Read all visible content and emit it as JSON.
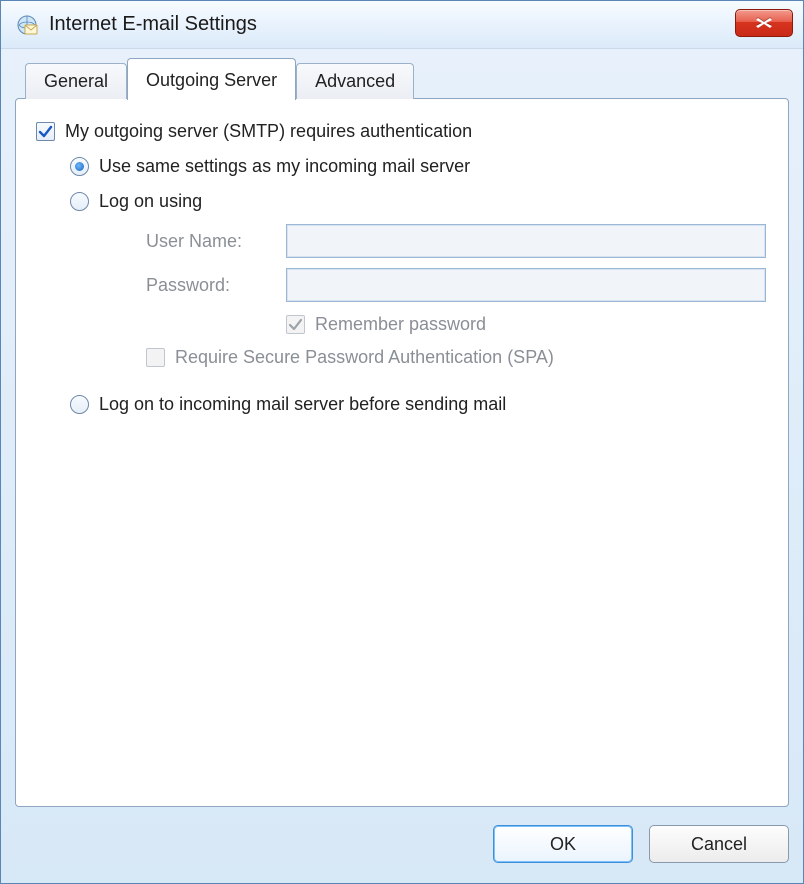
{
  "window": {
    "title": "Internet E-mail Settings"
  },
  "tabs": {
    "general": "General",
    "outgoing": "Outgoing Server",
    "advanced": "Advanced"
  },
  "form": {
    "requiresAuth": "My outgoing server (SMTP) requires authentication",
    "useSame": "Use same settings as my incoming mail server",
    "logOnUsing": "Log on using",
    "userNameLabel": "User Name:",
    "userNameValue": "",
    "passwordLabel": "Password:",
    "passwordValue": "",
    "rememberPassword": "Remember password",
    "requireSPA": "Require Secure Password Authentication (SPA)",
    "logOnIncoming": "Log on to incoming mail server before sending mail"
  },
  "buttons": {
    "ok": "OK",
    "cancel": "Cancel"
  }
}
